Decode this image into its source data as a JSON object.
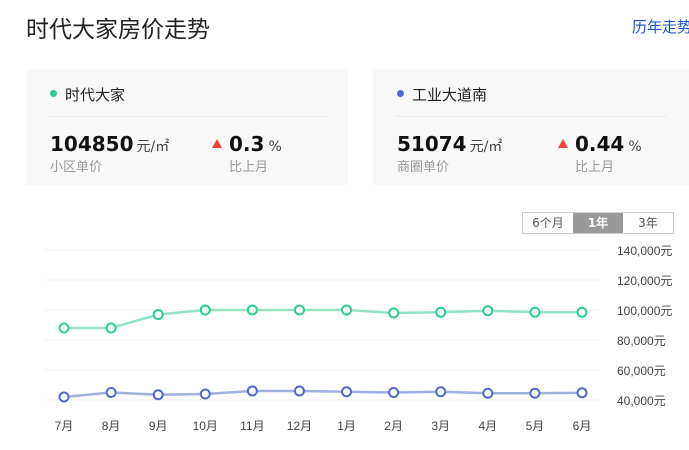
{
  "header": {
    "title": "时代大家房价走势",
    "history_link": "历年走势"
  },
  "cards": [
    {
      "name": "时代大家",
      "color": "#2ecc8f",
      "price": "104850",
      "unit": "元/㎡",
      "price_label": "小区单价",
      "change": "0.3",
      "change_unit": "%",
      "change_label": "比上月"
    },
    {
      "name": "工业大道南",
      "color": "#4f6bc9",
      "price": "51074",
      "unit": "元/㎡",
      "price_label": "商圈单价",
      "change": "0.44",
      "change_unit": "%",
      "change_label": "比上月"
    }
  ],
  "range_tabs": [
    {
      "label": "6个月"
    },
    {
      "label": "1年",
      "active": true
    },
    {
      "label": "3年"
    }
  ],
  "chart_data": {
    "type": "line",
    "categories": [
      "7月",
      "8月",
      "9月",
      "10月",
      "11月",
      "12月",
      "1月",
      "2月",
      "3月",
      "4月",
      "5月",
      "6月"
    ],
    "y_tick_labels": [
      "140,000元",
      "120,000元",
      "100,000元",
      "80,000元",
      "60,000元",
      "40,000元"
    ],
    "y_ticks": [
      140000,
      120000,
      100000,
      80000,
      60000,
      40000
    ],
    "ylim": [
      40000,
      140000
    ],
    "series": [
      {
        "name": "时代大家",
        "color": "#2ecc8f",
        "line_color": "#93e3c3",
        "values": [
          88000,
          88000,
          97000,
          100000,
          100000,
          100000,
          100000,
          98000,
          98500,
          99500,
          98500,
          98500
        ]
      },
      {
        "name": "工业大道南",
        "color": "#4f6bc9",
        "line_color": "#9fb0e3",
        "values": [
          42000,
          45000,
          43500,
          44000,
          46000,
          46000,
          45500,
          45000,
          45500,
          44500,
          44500,
          44800
        ]
      }
    ]
  }
}
